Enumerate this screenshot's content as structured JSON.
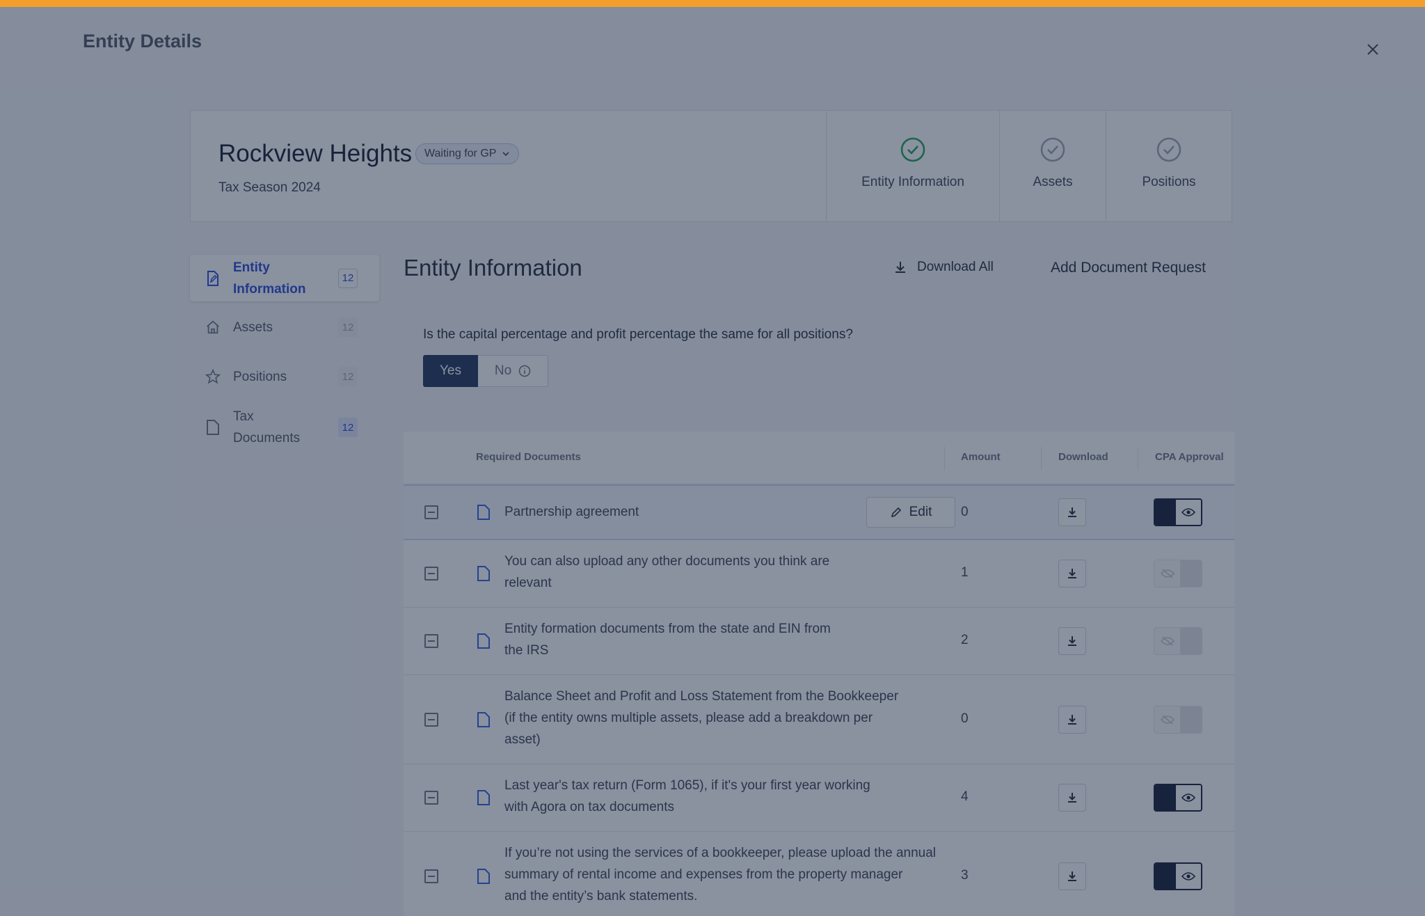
{
  "page": {
    "title": "Entity Details",
    "accent_color": "#f59e2b"
  },
  "entity": {
    "name": "Rockview Heights",
    "status": "Waiting for GP",
    "season": "Tax Season 2024"
  },
  "steps": [
    {
      "label": "Entity Information",
      "state": "complete",
      "color": "#16a34a"
    },
    {
      "label": "Assets",
      "state": "pending",
      "color": "#9ca3af"
    },
    {
      "label": "Positions",
      "state": "pending",
      "color": "#9ca3af"
    }
  ],
  "sidebar": {
    "items": [
      {
        "label": "Entity\nInformation",
        "count": "12",
        "icon": "document-edit-icon",
        "active": true
      },
      {
        "label": "Assets",
        "count": "12",
        "icon": "home-icon",
        "active": false
      },
      {
        "label": "Positions",
        "count": "12",
        "icon": "star-icon",
        "active": false
      },
      {
        "label": "Tax\nDocuments",
        "count": "12",
        "icon": "document-icon",
        "active": false
      }
    ]
  },
  "main": {
    "title": "Entity Information",
    "download_all": "Download All",
    "add_request": "Add Document Request",
    "question": "Is the capital percentage and profit percentage the same for all positions?",
    "yes_label": "Yes",
    "no_label": "No",
    "selected": "Yes"
  },
  "table": {
    "headers": {
      "documents": "Required Documents",
      "amount": "Amount",
      "download": "Download",
      "approval": "CPA Approval"
    },
    "edit_label": "Edit",
    "rows": [
      {
        "name": "Partnership agreement",
        "amount": "0",
        "approved": true,
        "editing": true
      },
      {
        "name": "You can also upload any other documents you think are\nrelevant",
        "amount": "1",
        "approved": false
      },
      {
        "name": "Entity formation documents from the state and EIN from\nthe IRS",
        "amount": "2",
        "approved": false
      },
      {
        "name": "Balance Sheet and Profit and Loss Statement from the Bookkeeper\n(if the entity owns multiple assets, please add a breakdown per\nasset)",
        "amount": "0",
        "approved": false
      },
      {
        "name": "Last year's tax return (Form 1065), if it's your first year working\nwith Agora on tax documents",
        "amount": "4",
        "approved": true
      },
      {
        "name": "If you’re not using the services of a bookkeeper, please upload the annual\nsummary of rental income and expenses from the property manager\n and the entity’s bank statements.",
        "amount": "3",
        "approved": true
      }
    ]
  }
}
